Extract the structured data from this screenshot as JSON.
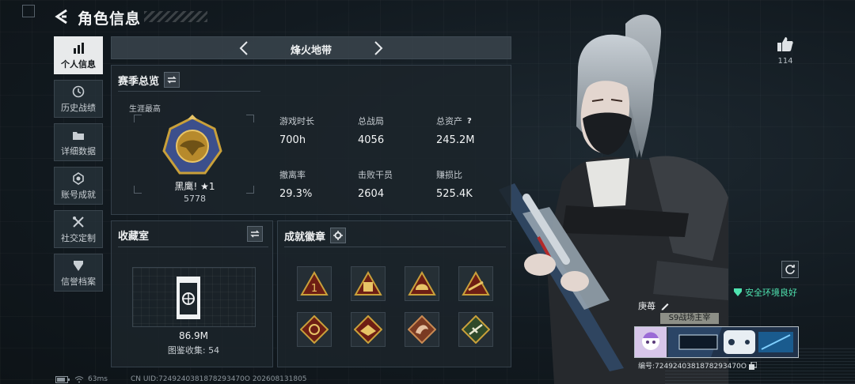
{
  "header": {
    "title": "角色信息"
  },
  "sidebar": {
    "items": [
      {
        "label": "个人信息",
        "icon": "bar-chart-icon",
        "active": true
      },
      {
        "label": "历史战绩",
        "icon": "clock-icon",
        "active": false
      },
      {
        "label": "详细数据",
        "icon": "folder-icon",
        "active": false
      },
      {
        "label": "账号成就",
        "icon": "medal-icon",
        "active": false
      },
      {
        "label": "社交定制",
        "icon": "tools-icon",
        "active": false
      },
      {
        "label": "信誉档案",
        "icon": "shield-icon",
        "active": false
      }
    ]
  },
  "mode": {
    "name": "烽火地带"
  },
  "season": {
    "title": "赛季总览",
    "career_label": "生涯最高",
    "rank_name": "黑鹰! ★1",
    "rank_score": "5778",
    "stats": [
      {
        "label": "游戏时长",
        "value": "700h"
      },
      {
        "label": "总战局",
        "value": "4056"
      },
      {
        "label": "总资产",
        "value": "245.2M",
        "help": "?"
      },
      {
        "label": "撤离率",
        "value": "29.3%"
      },
      {
        "label": "击败干员",
        "value": "2604"
      },
      {
        "label": "赚损比",
        "value": "525.4K"
      }
    ]
  },
  "collection": {
    "title": "收藏室",
    "value": "86.9M",
    "count_text": "图鉴收集: 54"
  },
  "badges": {
    "title": "成就徽章",
    "items": [
      "badge-1",
      "badge-2",
      "badge-3",
      "badge-4",
      "badge-5",
      "badge-6",
      "badge-7",
      "badge-8"
    ]
  },
  "profile": {
    "likes": "114",
    "safe_text": "安全环境良好",
    "name": "庚苺",
    "title_tag": "S9战场主宰",
    "id_text": "编号:7249240381878293470O"
  },
  "status": {
    "ping": "63ms",
    "uid_line": "CN UID:7249240381878293470O 202608131805"
  },
  "colors": {
    "accent_green": "#4fe3b0",
    "active_tab": "#e8eaeb",
    "badge_gold": "#c9a03a"
  }
}
